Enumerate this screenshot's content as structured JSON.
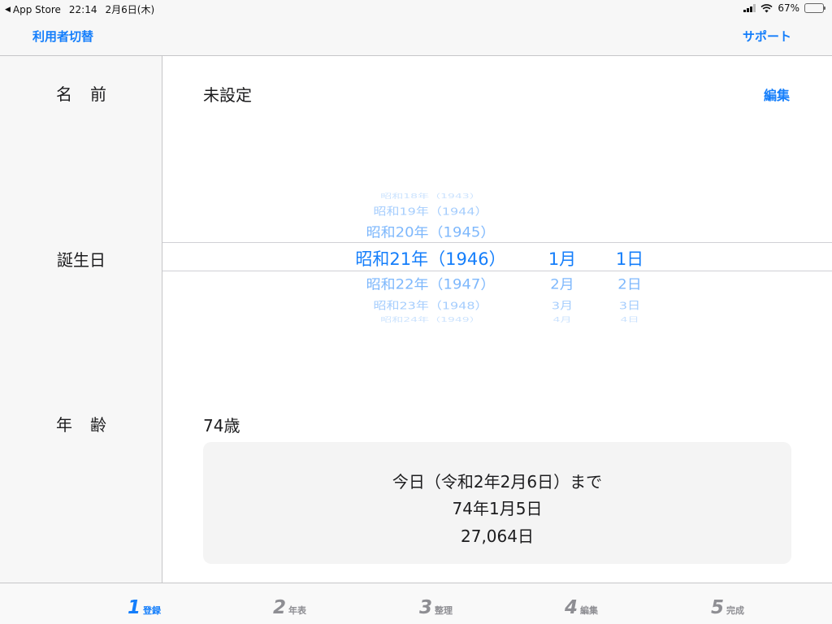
{
  "status_bar": {
    "back_app": "App Store",
    "time": "22:14",
    "date": "2月6日(木)",
    "battery": "67%",
    "battery_level": 0.67
  },
  "nav": {
    "left": "利用者切替",
    "right": "サポート"
  },
  "labels": {
    "name": "名前",
    "birthday": "誕生日",
    "age": "年齢"
  },
  "name": {
    "value": "未設定",
    "edit": "編集"
  },
  "picker": {
    "years": [
      "昭和18年（1943）",
      "昭和19年（1944）",
      "昭和20年（1945）",
      "昭和21年（1946）",
      "昭和22年（1947）",
      "昭和23年（1948）",
      "昭和24年（1949）"
    ],
    "months": [
      "1月",
      "2月",
      "3月",
      "4月"
    ],
    "days": [
      "1日",
      "2日",
      "3日",
      "4日"
    ]
  },
  "age": {
    "value": "74歳",
    "line1": "今日（令和2年2月6日）まで",
    "line2": "74年1月5日",
    "line3": "27,064日"
  },
  "tabs": [
    {
      "num": "1",
      "label": "登録"
    },
    {
      "num": "2",
      "label": "年表"
    },
    {
      "num": "3",
      "label": "整理"
    },
    {
      "num": "4",
      "label": "編集"
    },
    {
      "num": "5",
      "label": "完成"
    }
  ],
  "colors": {
    "accent": "#147efb",
    "inactive_tab": "#8e8e93",
    "sidebar_bg": "#f7f7f7"
  }
}
